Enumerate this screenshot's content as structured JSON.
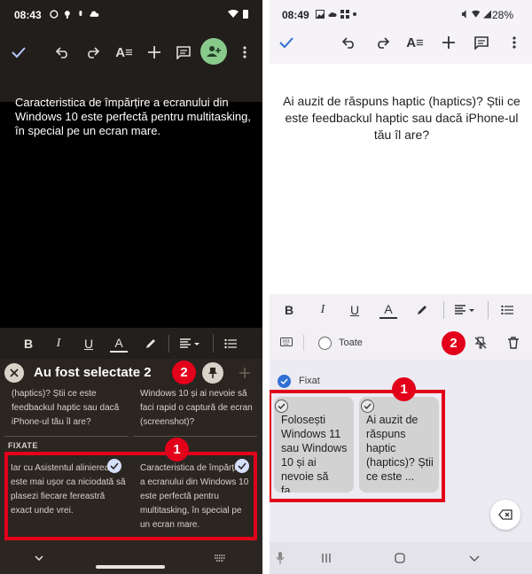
{
  "left": {
    "status_time": "08:43",
    "note_text": "Caracteristica de împărțire a ecranului din Windows 10 este perfectă pentru multitasking, în special pe un ecran mare.",
    "selection_title": "Au fost selectate 2",
    "cards_top": [
      "(haptics)? Știi ce este feedbackul haptic sau dacă iPhone-ul tău îl are?",
      "Windows 10 și ai nevoie să faci rapid o captură de ecran (screenshot)?"
    ],
    "section_label": "FIXATE",
    "pinned_cards": [
      "Iar cu Asistentul alinierea este mai ușor ca niciodată să plasezi fiecare fereastră exact unde vrei.",
      "Caracteristica de împărțire a ecranului din Windows 10 este perfectă pentru multitasking, în special pe un ecran mare."
    ]
  },
  "right": {
    "status_time": "08:49",
    "status_battery": "28%",
    "note_text": "Ai auzit de răspuns haptic (haptics)? Știi ce este feedbackul haptic sau dacă iPhone-ul tău îl are?",
    "select_all_label": "Toate",
    "section_label": "Fixat",
    "pinned_cards": [
      "Folosești Windows 11 sau Windows 10 și ai nevoie să fa...",
      "Ai auzit de răspuns haptic (haptics)? Știi ce este ..."
    ]
  },
  "annotations": {
    "badge_1": "1",
    "badge_2": "2"
  },
  "colors": {
    "left_bg": "#000000",
    "left_toolbar": "#211e1b",
    "left_notes_bg": "#2b2621",
    "add_user_green": "#88c98c",
    "right_accent": "#2f6fd6",
    "annotation_red": "#e2001a"
  },
  "icons": [
    "check-icon",
    "undo-icon",
    "redo-icon",
    "text-format-icon",
    "add-icon",
    "comment-icon",
    "add-person-icon",
    "more-vert-icon",
    "bold-icon",
    "italic-icon",
    "underline-icon",
    "text-color-icon",
    "highlight-icon",
    "align-icon",
    "list-icon",
    "close-icon",
    "pin-icon",
    "unpin-icon",
    "delete-icon",
    "keyboard-icon",
    "backspace-icon",
    "mic-icon"
  ]
}
